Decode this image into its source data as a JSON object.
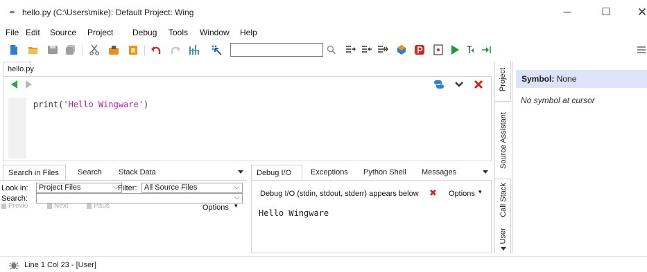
{
  "window": {
    "title": "hello.py (C:\\Users\\mike): Default Project: Wing",
    "controls": {
      "minimize": "─",
      "maximize": "☐",
      "close": "✕"
    }
  },
  "menu": [
    "File",
    "Edit",
    "Source",
    "Project",
    "Debug",
    "Tools",
    "Window",
    "Help"
  ],
  "toolbar": {
    "search_value": "",
    "icons": [
      "new-file-icon",
      "open-folder-icon",
      "save-icon",
      "save-all-icon",
      "cut-icon",
      "copy-icon",
      "paste-icon",
      "undo-icon",
      "redo-icon",
      "indent-icon",
      "goto-definition-icon",
      "search-icon",
      "step-into-icon",
      "step-over-icon",
      "step-out-icon",
      "debug-environment-icon",
      "stop-debug-icon",
      "breakpoint-icon",
      "run-icon",
      "pause-icon",
      "step-next-icon",
      "toolbar-menu-icon"
    ]
  },
  "editor": {
    "tab_label": "hello.py",
    "code": {
      "prefix": "print(",
      "string": "'Hello Wingware'",
      "suffix": ")"
    }
  },
  "search_panel": {
    "tabs": [
      "Search in Files",
      "Search",
      "Stack Data"
    ],
    "look_in_label": "Look in:",
    "look_in_value": "Project Files",
    "filter_label": "Filter:",
    "filter_value": "All Source Files",
    "search_label": "Search:",
    "search_value": "",
    "buttons": [
      "Previo",
      "Next",
      "Paus"
    ],
    "options_label": "Options"
  },
  "debug_panel": {
    "tabs": [
      "Debug I/O",
      "Exceptions",
      "Python Shell",
      "Messages"
    ],
    "info_text": "Debug I/O (stdin, stdout, stderr) appears below",
    "options_label": "Options",
    "output": "Hello Wingware"
  },
  "side_tabs": [
    "Project",
    "Source Assistant",
    "Call Stack",
    "User"
  ],
  "source_assistant": {
    "symbol_label": "Symbol:",
    "symbol_value": "None",
    "message": "No symbol at cursor"
  },
  "status": {
    "text": "Line 1 Col 23 - [User]"
  },
  "colors": {
    "run_green": "#1a9e3b",
    "close_red": "#d6241e",
    "assistant_header": "#dde3fb"
  }
}
